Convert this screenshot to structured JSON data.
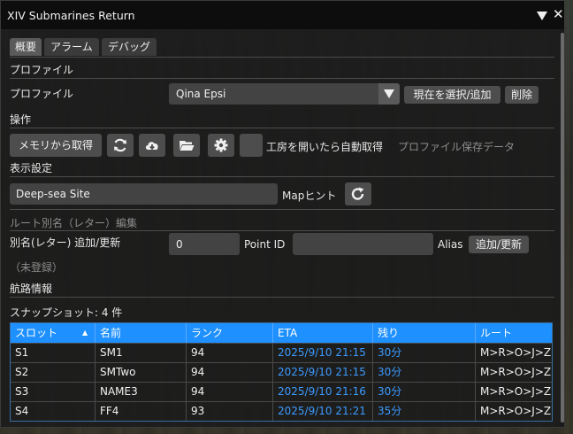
{
  "window": {
    "title": "XIV Submarines Return"
  },
  "tabs": [
    {
      "label": "概要"
    },
    {
      "label": "アラーム"
    },
    {
      "label": "デバッグ"
    }
  ],
  "profile": {
    "section_title": "プロファイル",
    "label": "プロファイル",
    "selected": "Qina Epsi",
    "select_add_button": "現在を選択/追加",
    "delete_button": "削除"
  },
  "operations": {
    "section_title": "操作",
    "fetch_memory_button": "メモリから取得",
    "auto_fetch_label": "工房を開いたら自動取得",
    "profile_save_label": "プロファイル保存データ",
    "icons": [
      "refresh-icon",
      "cloud-download-icon",
      "folder-open-icon",
      "gear-icon"
    ]
  },
  "display": {
    "section_title": "表示設定",
    "map_value": "Deep-sea Site",
    "map_hint_label": "Mapヒント"
  },
  "route_alias": {
    "section_title": "ルート別名（レター）編集",
    "add_update_label": "別名(レター) 追加/更新",
    "point_id_value": "0",
    "point_id_label": "Point ID",
    "alias_label": "Alias",
    "add_update_button": "追加/更新",
    "unregistered": "（未登録）"
  },
  "voyage": {
    "section_title": "航路情報",
    "snapshot_label": "スナップショット: 4 件"
  },
  "table": {
    "headers": [
      "スロット",
      "名前",
      "ランク",
      "ETA",
      "残り",
      "ルート"
    ],
    "rows": [
      [
        "S1",
        "SM1",
        "94",
        "2025/9/10 21:15",
        "30分",
        "M>R>O>J>Z"
      ],
      [
        "S2",
        "SMTwo",
        "94",
        "2025/9/10 21:15",
        "30分",
        "M>R>O>J>Z"
      ],
      [
        "S3",
        "NAME3",
        "94",
        "2025/9/10 21:16",
        "30分",
        "M>R>O>J>Z"
      ],
      [
        "S4",
        "FF4",
        "93",
        "2025/9/10 21:21",
        "35分",
        "M>R>O>J>Z"
      ]
    ]
  },
  "colors": {
    "accent": "#1e90ff",
    "link_blue": "#3c9bff",
    "panel": "#1c1c1c",
    "button": "#4d4d4d"
  }
}
